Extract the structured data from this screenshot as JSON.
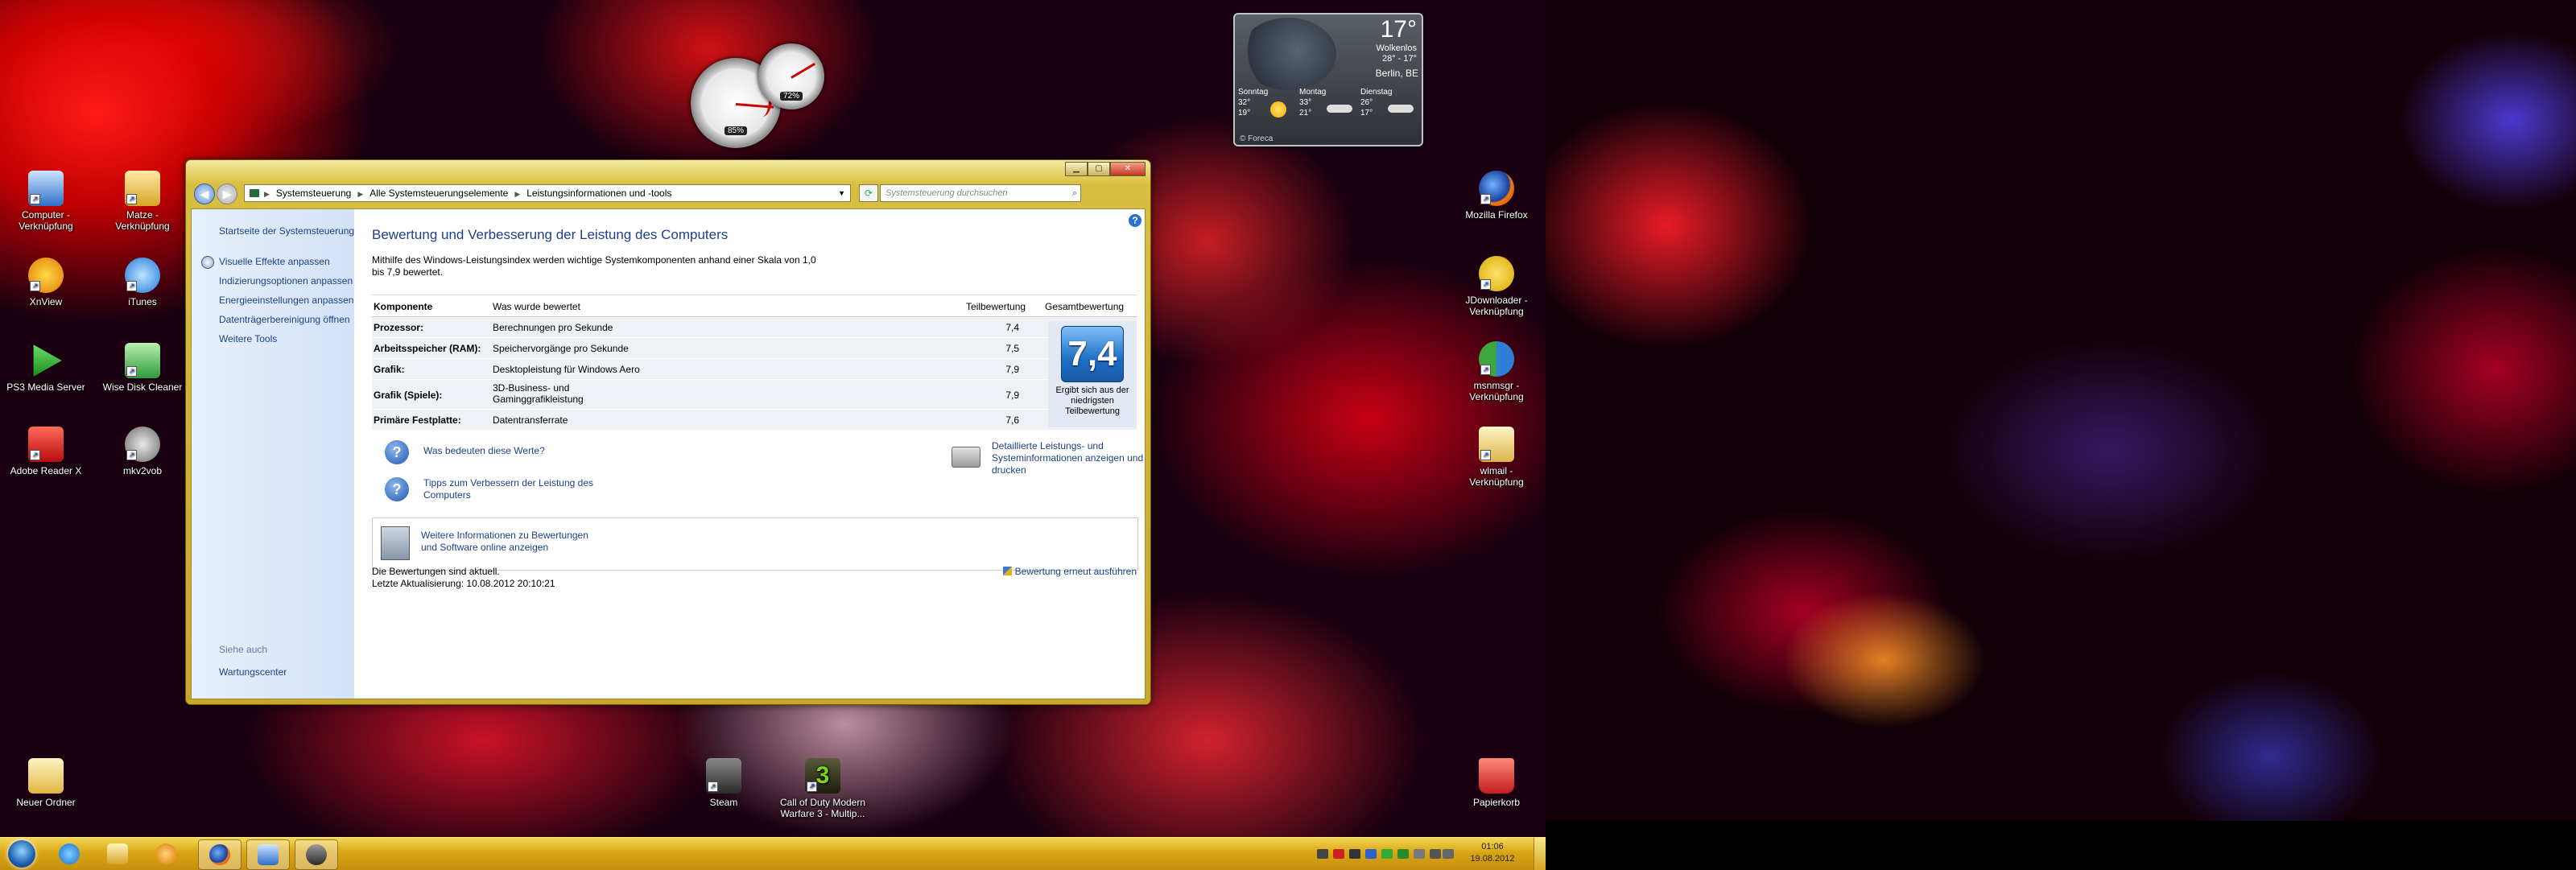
{
  "desktop_icons": {
    "computer": "Computer - Verknüpfung",
    "matze": "Matze - Verknüpfung",
    "xnview": "XnView",
    "itunes": "iTunes",
    "ps3": "PS3 Media Server",
    "wise": "Wise Disk Cleaner",
    "adobe": "Adobe Reader X",
    "mkv": "mkv2vob",
    "neuer": "Neuer Ordner",
    "steam": "Steam",
    "cod": "Call of Duty Modern Warfare 3 - Multip...",
    "firefox": "Mozilla Firefox",
    "jdownloader": "JDownloader - Verknüpfung",
    "msnmsgr": "msnmsgr - Verknüpfung",
    "wlmail": "wlmail - Verknüpfung",
    "papierkorb": "Papierkorb"
  },
  "gadgets": {
    "cpu_percent": "85%",
    "ram_percent": "72%",
    "cpu_level": 0.85,
    "ram_level": 0.72
  },
  "weather": {
    "temp": "17°",
    "condition": "Wolkenlos",
    "range": "28° - 17°",
    "city": "Berlin, BE",
    "days": [
      {
        "name": "Sonntag",
        "high": "32°",
        "low": "19°",
        "icon": "sun-icon"
      },
      {
        "name": "Montag",
        "high": "33°",
        "low": "21°",
        "icon": "cloud-icon"
      },
      {
        "name": "Dienstag",
        "high": "26°",
        "low": "17°",
        "icon": "cloud-icon"
      }
    ],
    "source": "© Foreca"
  },
  "window": {
    "controls": {
      "minimize": "▁",
      "maximize": "▢",
      "close": "✕"
    },
    "breadcrumb": [
      "Systemsteuerung",
      "Alle Systemsteuerungselemente",
      "Leistungsinformationen und -tools"
    ],
    "search_placeholder": "Systemsteuerung durchsuchen",
    "sidebar": {
      "home": "Startseite der Systemsteuerung",
      "links": [
        "Visuelle Effekte anpassen",
        "Indizierungsoptionen anpassen",
        "Energieeinstellungen anpassen",
        "Datenträgerbereinigung öffnen",
        "Weitere Tools"
      ],
      "see_also": "Siehe auch",
      "wartung": "Wartungscenter"
    },
    "title": "Bewertung und Verbesserung der Leistung des Computers",
    "intro": "Mithilfe des Windows-Leistungsindex werden wichtige Systemkomponenten anhand einer Skala von 1,0 bis 7,9 bewertet.",
    "table": {
      "headers": {
        "component": "Komponente",
        "rated": "Was wurde bewertet",
        "subscore": "Teilbewertung",
        "basescore": "Gesamtbewertung"
      },
      "rows": [
        {
          "component": "Prozessor:",
          "rated": "Berechnungen pro Sekunde",
          "score": "7,4"
        },
        {
          "component": "Arbeitsspeicher (RAM):",
          "rated": "Speichervorgänge pro Sekunde",
          "score": "7,5"
        },
        {
          "component": "Grafik:",
          "rated": "Desktopleistung für Windows Aero",
          "score": "7,9"
        },
        {
          "component": "Grafik (Spiele):",
          "rated": "3D-Business- und Gaminggrafikleistung",
          "score": "7,9"
        },
        {
          "component": "Primäre Festplatte:",
          "rated": "Datentransferrate",
          "score": "7,6"
        }
      ],
      "base_score": "7,4",
      "base_caption": "Ergibt sich aus der niedrigsten Teilbewertung"
    },
    "links": {
      "meaning": "Was bedeuten diese Werte?",
      "tips": "Tipps zum Verbessern der Leistung des Computers",
      "details": "Detaillierte Leistungs- und Systeminformationen anzeigen und drucken",
      "moreinfo": "Weitere Informationen zu Bewertungen und Software online anzeigen"
    },
    "status": {
      "current": "Die Bewertungen sind aktuell.",
      "updated": "Letzte Aktualisierung: 10.08.2012 20:10:21",
      "rerun": "Bewertung erneut ausführen"
    }
  },
  "taskbar": {
    "time": "01:06",
    "date": "19.08.2012"
  }
}
